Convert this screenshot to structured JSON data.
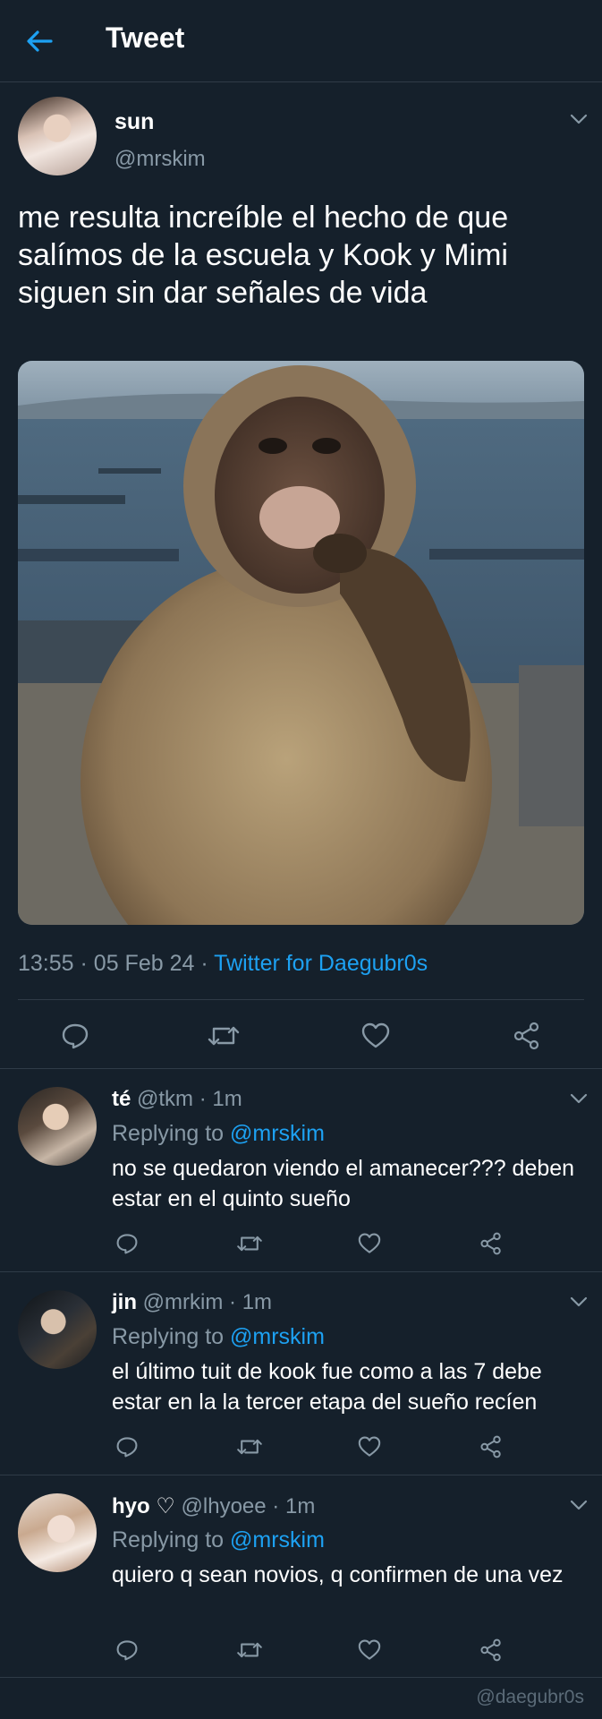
{
  "header": {
    "title": "Tweet"
  },
  "main_tweet": {
    "name": "sun",
    "handle": "@mrskim",
    "text": "me resulta increíble el hecho de que salímos de la escuela y Kook y Mimi siguen sin dar señales de vida",
    "time": "13:55",
    "date": "05 Feb 24",
    "source": "Twitter for Daegubr0s",
    "image_description": "monkey"
  },
  "replies": [
    {
      "name": "té",
      "handle": "@tkm",
      "time": "1m",
      "replying_label": "Replying to",
      "replying_to": "@mrskim",
      "text": "no se quedaron viendo el amanecer??? deben estar en el quinto sueño"
    },
    {
      "name": "jin",
      "handle": "@mrkim",
      "time": "1m",
      "replying_label": "Replying to",
      "replying_to": "@mrskim",
      "text": "el último tuit de kook fue como a las 7 debe estar en la la tercer etapa del sueño recíen"
    },
    {
      "name": "hyo",
      "name_symbol": "♡",
      "handle": "@lhyoee",
      "time": "1m",
      "replying_label": "Replying to",
      "replying_to": "@mrskim",
      "text": "quiero q sean novios, q confirmen de una vez"
    }
  ],
  "separator": "·",
  "watermark": "@daegubr0s",
  "colors": {
    "background": "#15202b",
    "accent": "#1da1f2",
    "muted": "#8899a6",
    "divider": "#2f3b47"
  },
  "icons": [
    "back-arrow-icon",
    "chevron-down-icon",
    "reply-icon",
    "retweet-icon",
    "like-icon",
    "share-icon"
  ]
}
